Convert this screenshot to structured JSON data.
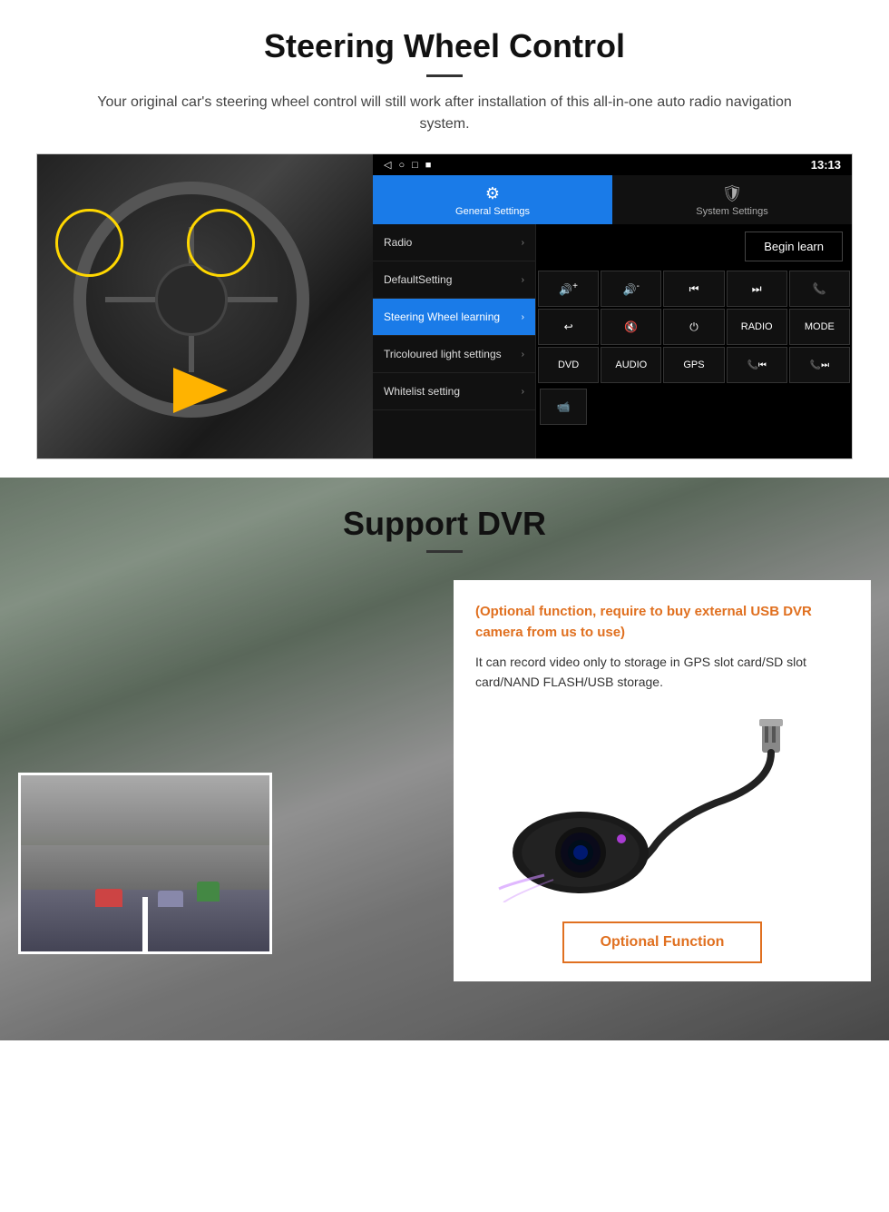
{
  "steering_section": {
    "title": "Steering Wheel Control",
    "subtitle": "Your original car's steering wheel control will still work after installation of this all-in-one auto radio navigation system.",
    "android_ui": {
      "statusbar": {
        "time": "13:13",
        "symbols": [
          "◁",
          "○",
          "□",
          "■"
        ]
      },
      "tabs": [
        {
          "label": "General Settings",
          "active": true
        },
        {
          "label": "System Settings",
          "active": false
        }
      ],
      "menu_items": [
        {
          "label": "Radio",
          "active": false
        },
        {
          "label": "DefaultSetting",
          "active": false
        },
        {
          "label": "Steering Wheel learning",
          "active": true
        },
        {
          "label": "Tricoloured light settings",
          "active": false
        },
        {
          "label": "Whitelist setting",
          "active": false
        }
      ],
      "begin_learn_label": "Begin learn",
      "control_buttons": [
        "VOL+",
        "VOL-",
        "⏮",
        "⏭",
        "☎",
        "↩",
        "🔇",
        "⏻",
        "RADIO",
        "MODE",
        "DVD",
        "AUDIO",
        "GPS",
        "☎⏮",
        "☎⏭"
      ],
      "extra_btn": "📹"
    }
  },
  "dvr_section": {
    "title": "Support DVR",
    "optional_text": "(Optional function, require to buy external USB DVR camera from us to use)",
    "description": "It can record video only to storage in GPS slot card/SD slot card/NAND FLASH/USB storage.",
    "optional_function_label": "Optional Function"
  }
}
